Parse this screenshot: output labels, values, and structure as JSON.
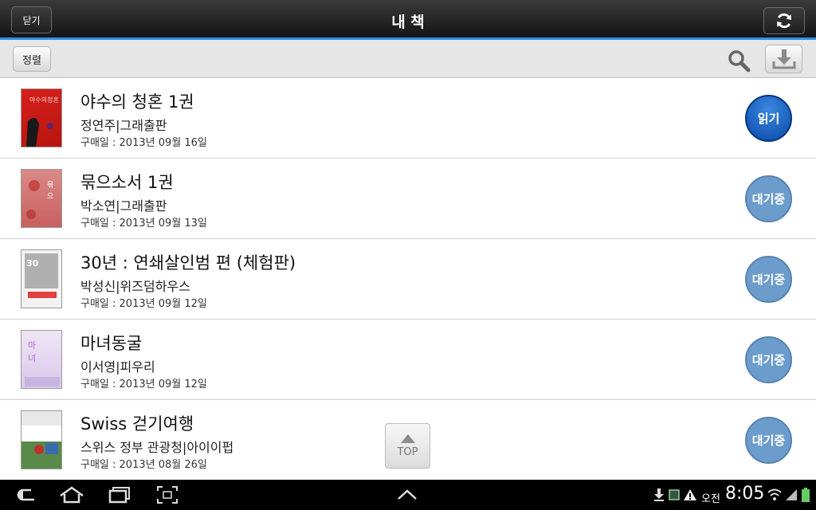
{
  "header": {
    "close_label": "닫기",
    "title": "내 책",
    "refresh_icon": "refresh-icon"
  },
  "toolbar": {
    "sort_label": "정렬",
    "search_icon": "search-icon",
    "download_icon": "download-icon"
  },
  "books": [
    {
      "title": "야수의 청혼 1권",
      "author": "정연주|그래출판",
      "date": "구매일 : 2013년 09월 16일",
      "action": "읽기",
      "state": "read"
    },
    {
      "title": "묶으소서 1권",
      "author": "박소연|그래출판",
      "date": "구매일 : 2013년 09월 13일",
      "action": "대기중",
      "state": "wait"
    },
    {
      "title": "30년 : 연쇄살인범 편 (체험판)",
      "author": "박성신|위즈덤하우스",
      "date": "구매일 : 2013년 09월 12일",
      "action": "대기중",
      "state": "wait"
    },
    {
      "title": "마녀동굴",
      "author": "이서영|피우리",
      "date": "구매일 : 2013년 09월 12일",
      "action": "대기중",
      "state": "wait"
    },
    {
      "title": "Swiss 걷기여행",
      "author": "스위스 정부 관광청|아이이펍",
      "date": "구매일 : 2013년 08월 26일",
      "action": "대기중",
      "state": "wait"
    }
  ],
  "top_button": {
    "label": "TOP"
  },
  "statusbar": {
    "ampm": "오전",
    "time": "8:05"
  },
  "colors": {
    "accent": "#2f8fe0",
    "read_button": "#0a4aa8",
    "wait_button": "#6b9ccc"
  }
}
